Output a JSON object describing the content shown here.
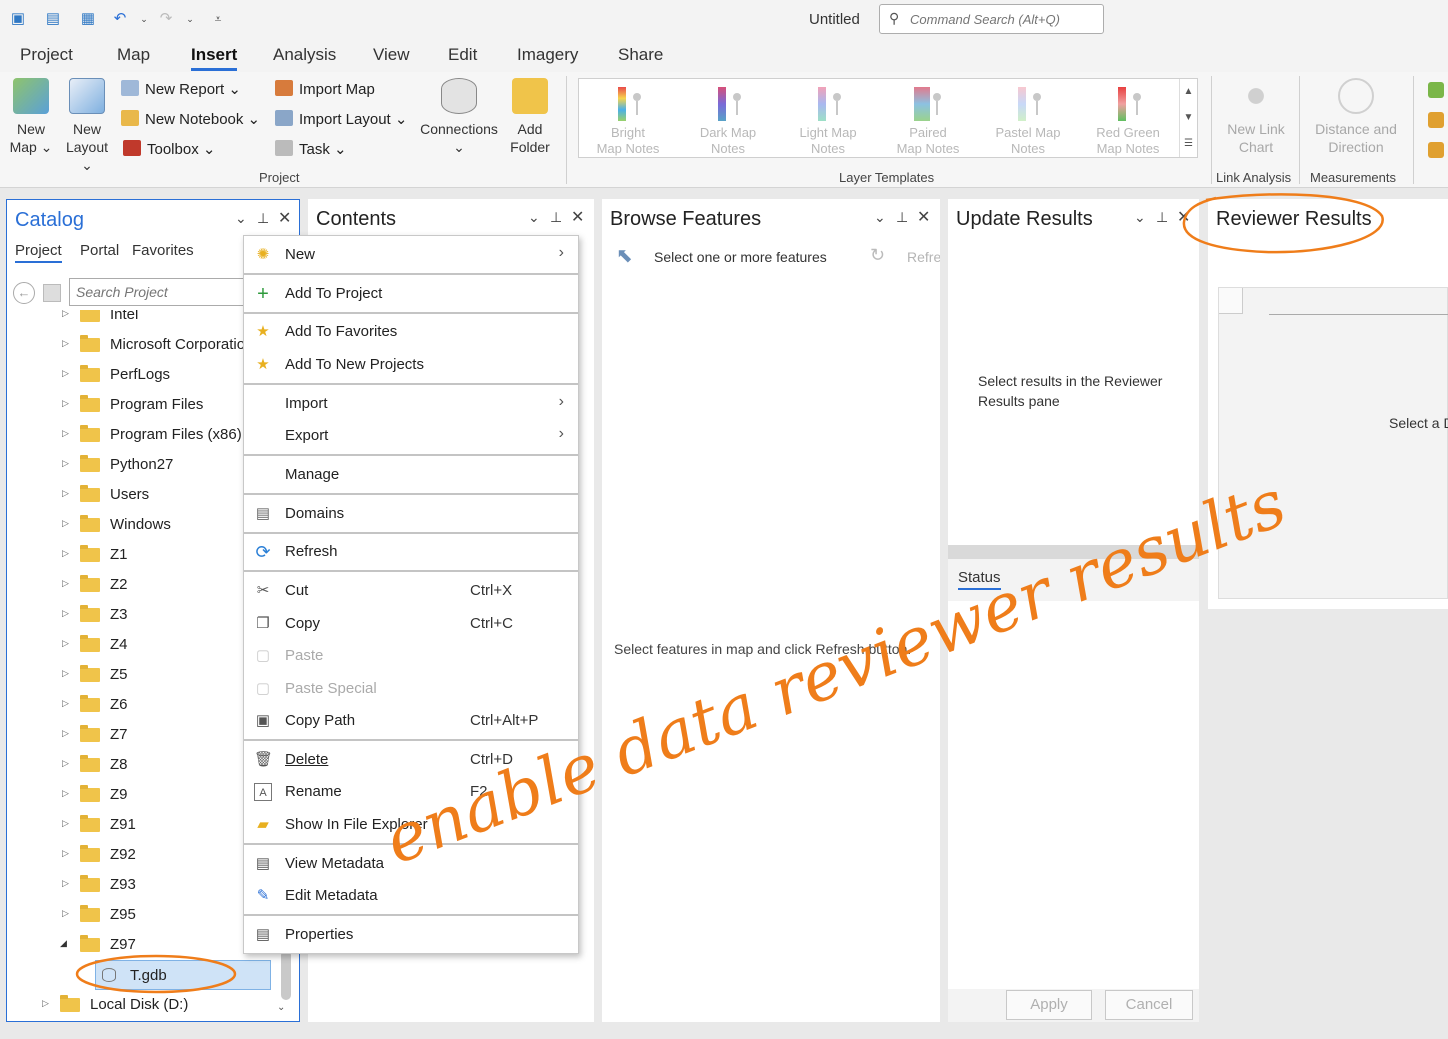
{
  "titlebar": {
    "doc_title": "Untitled",
    "search_placeholder": "Command Search (Alt+Q)"
  },
  "tabs": [
    "Project",
    "Map",
    "Insert",
    "Analysis",
    "View",
    "Edit",
    "Imagery",
    "Share"
  ],
  "ribbon": {
    "new_map": [
      "New",
      "Map"
    ],
    "new_layout": [
      "New",
      "Layout"
    ],
    "new_report": "New Report",
    "new_notebook": "New Notebook",
    "toolbox": "Toolbox",
    "import_map": "Import Map",
    "import_layout": "Import Layout",
    "task": "Task",
    "connections": "Connections",
    "add_folder": [
      "Add",
      "Folder"
    ],
    "project_group": "Project",
    "layer_templates_group": "Layer Templates",
    "templates": [
      [
        "Bright",
        "Map Notes"
      ],
      [
        "Dark Map",
        "Notes"
      ],
      [
        "Light Map",
        "Notes"
      ],
      [
        "Paired",
        "Map Notes"
      ],
      [
        "Pastel Map",
        "Notes"
      ],
      [
        "Red Green",
        "Map Notes"
      ]
    ],
    "new_link_chart": [
      "New Link",
      "Chart"
    ],
    "link_analysis_group": "Link Analysis",
    "distance_direction": [
      "Distance and",
      "Direction"
    ],
    "measurements_group": "Measurements"
  },
  "catalog": {
    "title": "Catalog",
    "subtabs": [
      "Project",
      "Portal",
      "Favorites"
    ],
    "search_placeholder": "Search Project",
    "items": [
      "Intel",
      "Microsoft Corporation",
      "PerfLogs",
      "Program Files",
      "Program Files (x86)",
      "Python27",
      "Users",
      "Windows",
      "Z1",
      "Z2",
      "Z3",
      "Z4",
      "Z5",
      "Z6",
      "Z7",
      "Z8",
      "Z9",
      "Z91",
      "Z92",
      "Z93",
      "Z95",
      "Z97"
    ],
    "selected_item": "T.gdb",
    "local_disk": "Local Disk (D:)"
  },
  "context_menu": [
    {
      "label": "New",
      "submenu": true
    },
    {
      "label": "Add To Project"
    },
    {
      "label": "Add To Favorites"
    },
    {
      "label": "Add To New Projects"
    },
    {
      "label": "Import",
      "submenu": true
    },
    {
      "label": "Export",
      "submenu": true
    },
    {
      "label": "Manage"
    },
    {
      "label": "Domains"
    },
    {
      "label": "Refresh"
    },
    {
      "label": "Cut",
      "shortcut": "Ctrl+X"
    },
    {
      "label": "Copy",
      "shortcut": "Ctrl+C"
    },
    {
      "label": "Paste",
      "disabled": true
    },
    {
      "label": "Paste Special",
      "disabled": true
    },
    {
      "label": "Copy Path",
      "shortcut": "Ctrl+Alt+P"
    },
    {
      "label": "Delete",
      "shortcut": "Ctrl+D"
    },
    {
      "label": "Rename",
      "shortcut": "F2"
    },
    {
      "label": "Show In File Explorer"
    },
    {
      "label": "View Metadata"
    },
    {
      "label": "Edit Metadata"
    },
    {
      "label": "Properties"
    }
  ],
  "contents": {
    "title": "Contents"
  },
  "browse": {
    "title": "Browse Features",
    "select_text": "Select one or more features",
    "refresh_label": "Refresh",
    "hint": "Select features in map and click Refresh button."
  },
  "update": {
    "title": "Update Results",
    "message": [
      "Select results in the Reviewer",
      "Results pane"
    ],
    "status_tab": "Status",
    "apply": "Apply",
    "cancel": "Cancel"
  },
  "reviewer": {
    "title": "Reviewer Results",
    "message": "Select a D"
  },
  "annotation": {
    "text": "enable data reviewer results",
    "color": "#ef7d1a"
  }
}
